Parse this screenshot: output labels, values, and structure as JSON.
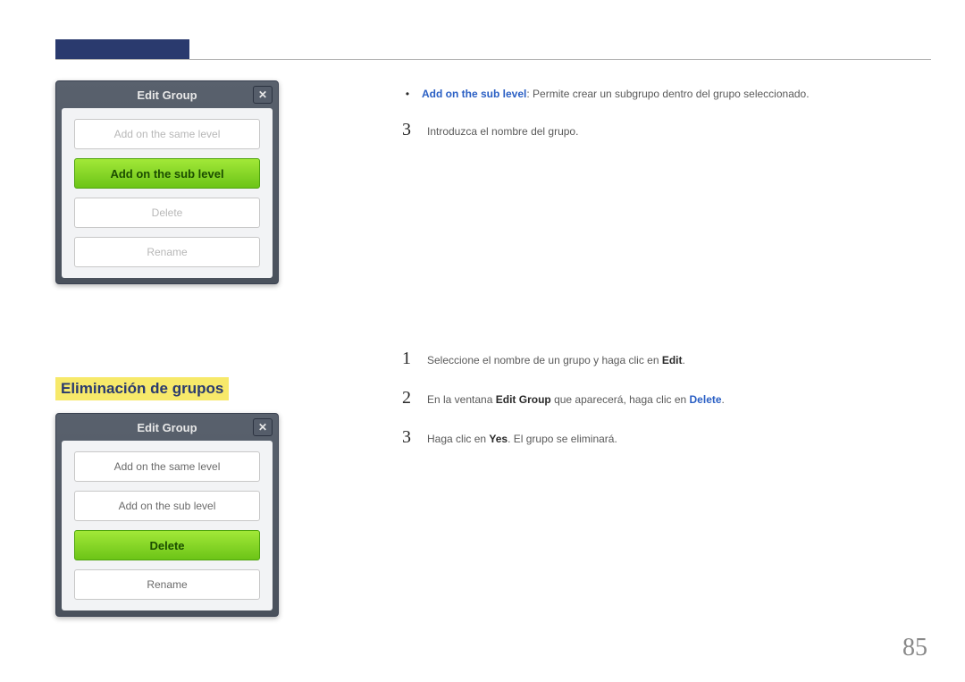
{
  "page_number": "85",
  "section_heading": "Eliminación de grupos",
  "dialog1": {
    "title": "Edit Group",
    "close": "✕",
    "buttons": {
      "same_level": "Add on the same level",
      "sub_level": "Add on the sub level",
      "delete": "Delete",
      "rename": "Rename"
    }
  },
  "dialog2": {
    "title": "Edit Group",
    "close": "✕",
    "buttons": {
      "same_level": "Add on the same level",
      "sub_level": "Add on the sub level",
      "delete": "Delete",
      "rename": "Rename"
    }
  },
  "top_bullet": {
    "bold": "Add on the sub level",
    "rest": ": Permite crear un subgrupo dentro del grupo seleccionado."
  },
  "top_step3": {
    "num": "3",
    "text": "Introduzca el nombre del grupo."
  },
  "steps": {
    "s1": {
      "num": "1",
      "pre": "Seleccione el nombre de un grupo y haga clic en ",
      "bold": "Edit",
      "post": "."
    },
    "s2": {
      "num": "2",
      "pre": "En la ventana ",
      "bold1": "Edit Group",
      "mid": " que aparecerá, haga clic en ",
      "bold2": "Delete",
      "post": "."
    },
    "s3": {
      "num": "3",
      "pre": "Haga clic en ",
      "bold": "Yes",
      "post": ". El grupo se eliminará."
    }
  }
}
